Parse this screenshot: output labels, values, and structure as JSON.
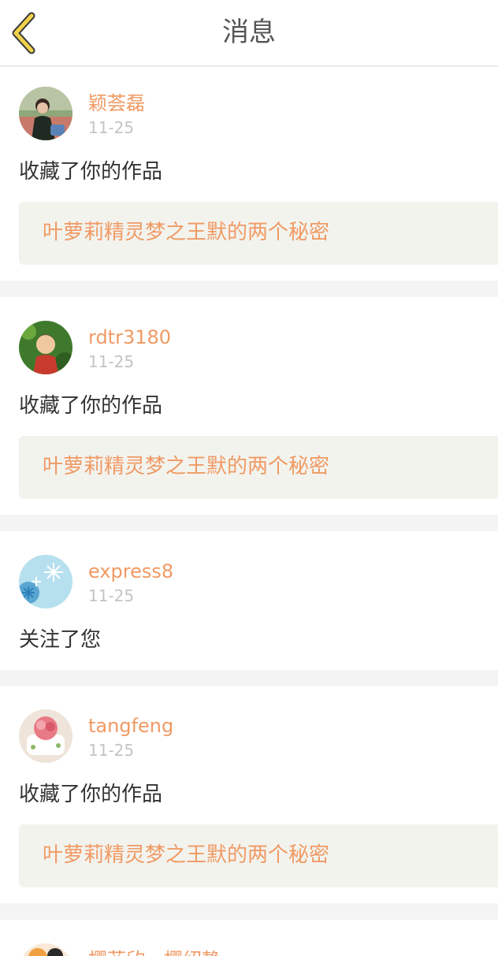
{
  "header": {
    "title": "消息",
    "back_icon": "chevron-left-icon",
    "back_color": "#f0d24a"
  },
  "colors": {
    "accent": "#f09a64",
    "time": "#c4c4c4",
    "text": "#333333",
    "box": "#f3f3ee"
  },
  "messages": [
    {
      "username": "颖荟磊",
      "time": "11-25",
      "action": "收藏了你的作品",
      "work": "叶萝莉精灵梦之王默的两个秘密",
      "avatar_icon": "child-photo-avatar"
    },
    {
      "username": "rdtr3180",
      "time": "11-25",
      "action": "收藏了你的作品",
      "work": "叶萝莉精灵梦之王默的两个秘密",
      "avatar_icon": "girl-photo-avatar"
    },
    {
      "username": "express8",
      "time": "11-25",
      "action": "关注了您",
      "avatar_icon": "snowflake-avatar"
    },
    {
      "username": "tangfeng",
      "time": "11-25",
      "action": "收藏了你的作品",
      "work": "叶萝莉精灵梦之王默的两个秘密",
      "avatar_icon": "cake-avatar"
    },
    {
      "username": "樱菲欣，樱绍静",
      "avatar_icon": "cartoon-avatar"
    }
  ]
}
